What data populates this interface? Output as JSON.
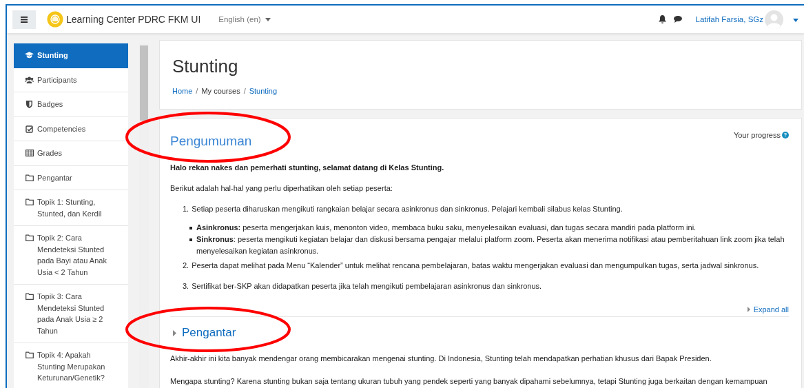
{
  "navbar": {
    "site_name": "Learning Center PDRC FKM UI",
    "language": "English (en)",
    "user_name": "Latifah Farsia, SGz"
  },
  "sidebar": {
    "items": [
      {
        "label": "Stunting",
        "kind": "course",
        "selected": true
      },
      {
        "label": "Participants",
        "kind": "participants",
        "selected": false
      },
      {
        "label": "Badges",
        "kind": "badges",
        "selected": false
      },
      {
        "label": "Competencies",
        "kind": "competencies",
        "selected": false
      },
      {
        "label": "Grades",
        "kind": "grades",
        "selected": false
      },
      {
        "label": "Pengantar",
        "kind": "section",
        "selected": false
      },
      {
        "label": "Topik 1: Stunting, Stunted, dan Kerdil",
        "kind": "section",
        "selected": false
      },
      {
        "label": "Topik 2: Cara Mendeteksi Stunted pada Bayi atau Anak Usia < 2 Tahun",
        "kind": "section",
        "selected": false
      },
      {
        "label": "Topik 3: Cara Mendeteksi Stunted pada Anak Usia ≥ 2 Tahun",
        "kind": "section",
        "selected": false
      },
      {
        "label": "Topik 4: Apakah Stunting Merupakan Keturunan/Genetik?",
        "kind": "section",
        "selected": false
      }
    ]
  },
  "header": {
    "title": "Stunting",
    "breadcrumb": [
      {
        "kind": "link",
        "label": "Home"
      },
      {
        "kind": "separator",
        "label": "/"
      },
      {
        "kind": "text",
        "label": "My courses"
      },
      {
        "kind": "separator",
        "label": "/"
      },
      {
        "kind": "link",
        "label": "Stunting"
      }
    ]
  },
  "announcement": {
    "title": "Pengumuman",
    "progress_label": "Your progress",
    "help_icon": "?",
    "intro": "Halo rekan nakes dan pemerhati stunting, selamat datang di Kelas Stunting.",
    "lead": "Berikut adalah hal-hal yang perlu diperhatikan oleh setiap peserta:",
    "points": [
      {
        "number": "1.",
        "text": "Setiap peserta diharuskan mengikuti rangkaian belajar secara asinkronus dan sinkronus. Pelajari kembali silabus kelas Stunting.",
        "bullets": [
          "**Asinkronus:** peserta mengerjakan kuis, menonton video, membaca buku saku, menyelesaikan evaluasi, dan tugas secara mandiri pada platform ini.",
          "**Sinkronus**: peserta mengikuti kegiatan belajar dan diskusi bersama pengajar melalui platform zoom. Peserta akan menerima notifikasi atau pemberitahuan link zoom jika telah menyelesaikan kegiatan asinkronus."
        ]
      },
      {
        "number": "2.",
        "text": "Peserta dapat melihat pada Menu “Kalender” untuk melihat rencana pembelajaran, batas waktu mengerjakan evaluasi dan mengumpulkan tugas, serta jadwal sinkronus."
      },
      {
        "number": "3.",
        "text": "Sertifikat ber-SKP akan didapatkan peserta jika telah mengikuti pembelajaran asinkronus dan sinkronus."
      }
    ]
  },
  "expand_all": "Expand all",
  "section": {
    "title": "Pengantar",
    "expanded": false,
    "paragraphs": [
      "Akhir-akhir ini kita banyak mendengar orang membicarakan mengenai stunting. Di Indonesia, Stunting telah mendapatkan perhatian khusus dari Bapak Presiden.",
      "Mengapa stunting? Karena stunting bukan saja tentang ukuran tubuh yang pendek seperti yang banyak dipahami sebelumnya, tetapi Stunting juga berkaitan dengan kemampuan"
    ]
  }
}
